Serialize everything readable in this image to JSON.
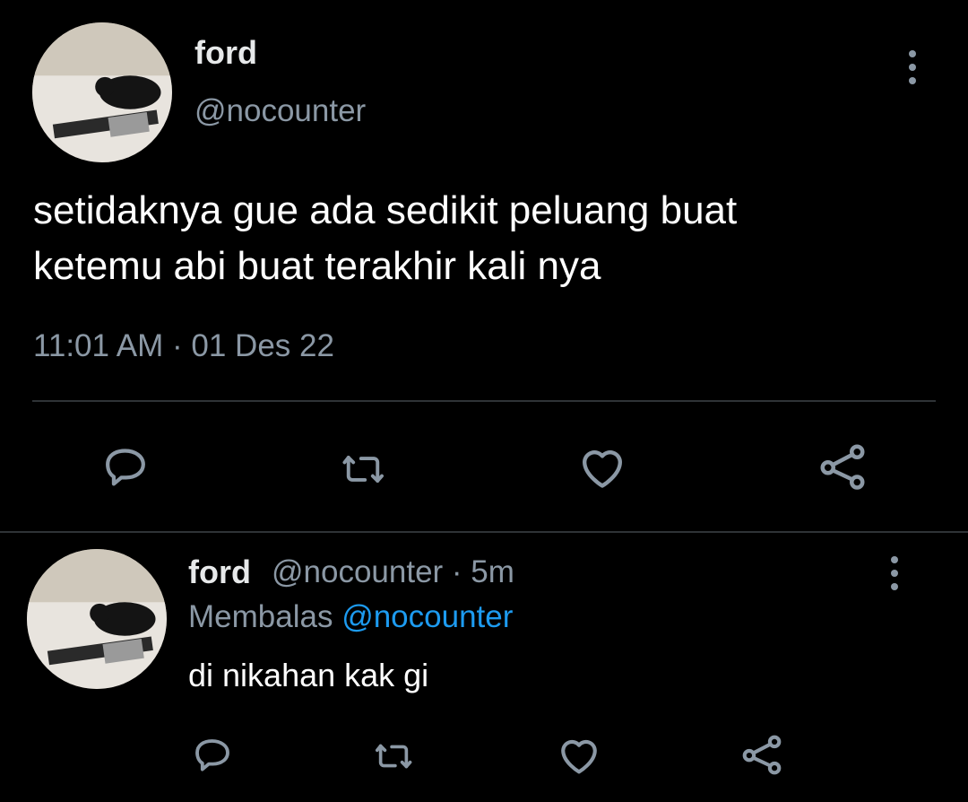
{
  "main_tweet": {
    "display_name": "ford",
    "handle": "@nocounter",
    "text_line1": "setidaknya gue ada sedikit peluang buat",
    "text_line2": "ketemu abi buat terakhir kali nya",
    "timestamp": "11:01 AM · 01 Des 22",
    "actions": [
      "reply-icon",
      "retweet-icon",
      "like-icon",
      "share-icon"
    ]
  },
  "reply_tweet": {
    "display_name": "ford",
    "handle_and_time": "@nocounter · 5m",
    "replying_label": "Membalas",
    "replying_to": "@nocounter",
    "text": "di nikahan kak gi",
    "actions": [
      "reply-icon",
      "retweet-icon",
      "like-icon",
      "share-icon"
    ]
  },
  "colors": {
    "background": "#000000",
    "text": "#e7e9ea",
    "muted": "#8b98a5",
    "link": "#1d9bf0",
    "divider": "#2f3336"
  }
}
